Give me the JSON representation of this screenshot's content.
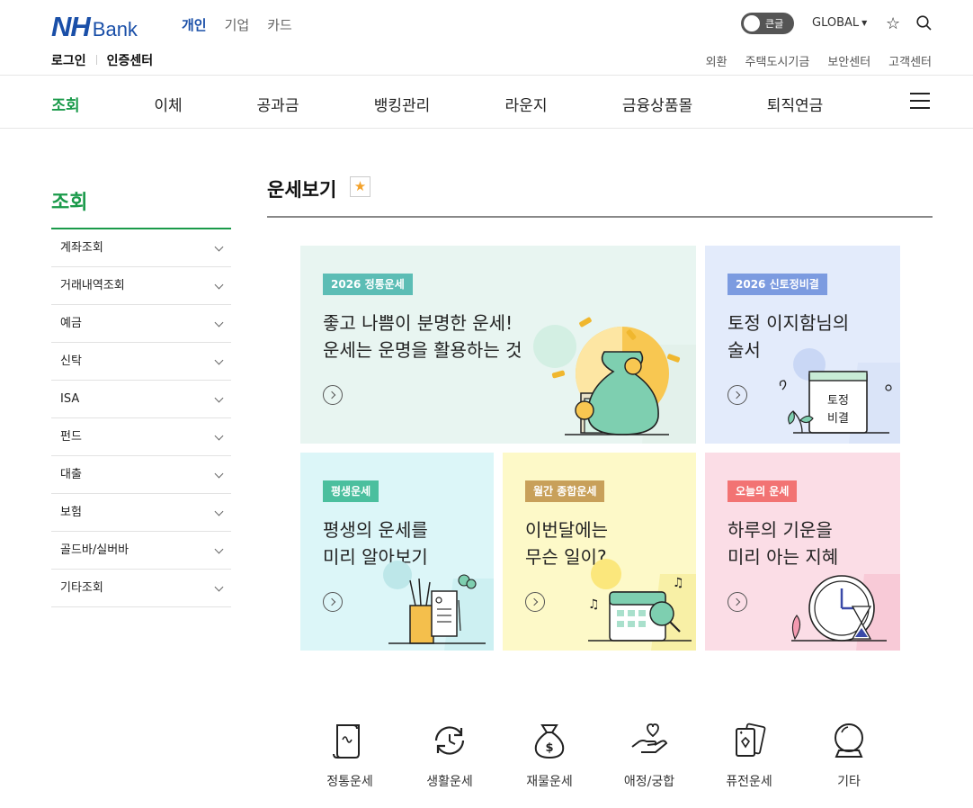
{
  "header": {
    "logo_nh": "NH",
    "logo_bank": "Bank",
    "segments": [
      "개인",
      "기업",
      "카드"
    ],
    "toggle_label": "큰글",
    "global_label": "GLOBAL",
    "util_left": [
      "로그인",
      "인증센터"
    ],
    "util_right": [
      "외환",
      "주택도시기금",
      "보안센터",
      "고객센터"
    ]
  },
  "gnb": [
    "조회",
    "이체",
    "공과금",
    "뱅킹관리",
    "라운지",
    "금융상품몰",
    "퇴직연금"
  ],
  "sidebar": {
    "title": "조회",
    "items": [
      "계좌조회",
      "거래내역조회",
      "예금",
      "신탁",
      "ISA",
      "펀드",
      "대출",
      "보험",
      "골드바/실버바",
      "기타조회"
    ]
  },
  "page": {
    "title": "운세보기",
    "cards": [
      {
        "badge": "2026 정통운세",
        "text": "좋고 나쁨이 분명한 운세!\n운세는 운명을 활용하는 것",
        "bg": "#e8f5f1",
        "badge_color": "#5cbdb5"
      },
      {
        "badge": "2026 신토정비결",
        "text": "토정 이지함님의\n술서",
        "bg": "#e3ebfb",
        "badge_color": "#7c9be0",
        "book_text": "토정\n비결"
      },
      {
        "badge": "평생운세",
        "text": "평생의 운세를\n미리 알아보기",
        "bg": "#dcf6f8",
        "badge_color": "#4bbf9e"
      },
      {
        "badge": "월간 종합운세",
        "text": "이번달에는\n무슨 일이?",
        "bg": "#fdf9c8",
        "badge_color": "#c8a05a"
      },
      {
        "badge": "오늘의 운세",
        "text": "하루의 기운을\n미리 아는 지혜",
        "bg": "#fbdde6",
        "badge_color": "#f27373"
      }
    ]
  },
  "bottom_icons": [
    {
      "label": "정통운세",
      "icon": "scroll-icon"
    },
    {
      "label": "생활운세",
      "icon": "cycle-icon"
    },
    {
      "label": "재물운세",
      "icon": "money-bag-icon"
    },
    {
      "label": "애정/궁합",
      "icon": "heart-hand-icon"
    },
    {
      "label": "퓨전운세",
      "icon": "cards-icon"
    },
    {
      "label": "기타",
      "icon": "crystal-ball-icon"
    }
  ]
}
